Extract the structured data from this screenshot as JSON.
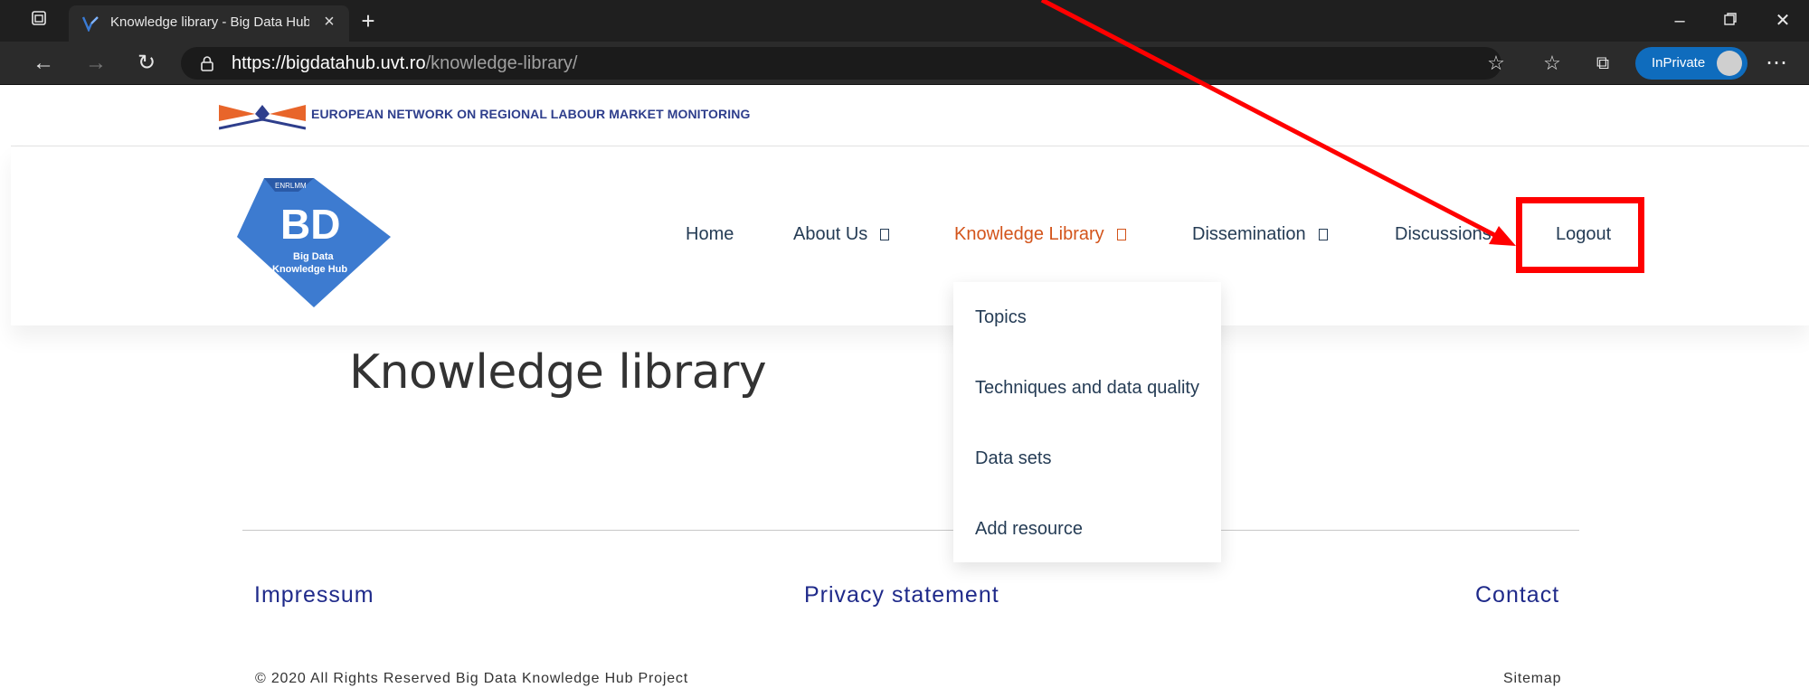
{
  "browser": {
    "tab_title": "Knowledge library - Big Data Hub",
    "url_scheme": "https://",
    "url_host": "bigdatahub.uvt.ro",
    "url_path": "/knowledge-library/",
    "inprivate_label": "InPrivate"
  },
  "site": {
    "network_name": "EUROPEAN NETWORK ON REGIONAL LABOUR MARKET MONITORING",
    "logo_small_text": "ENRLMM",
    "logo_letters": "BD",
    "logo_caption_line1": "Big Data",
    "logo_caption_line2": "Knowledge Hub"
  },
  "nav": {
    "home": "Home",
    "about": "About Us",
    "knowledge_library": "Knowledge Library",
    "dissemination": "Dissemination",
    "discussions": "Discussions",
    "logout": "Logout"
  },
  "dropdown": {
    "items": [
      "Topics",
      "Techniques and data quality",
      "Data sets",
      "Add resource"
    ]
  },
  "main": {
    "page_title": "Knowledge library"
  },
  "footer": {
    "impressum": "Impressum",
    "privacy": "Privacy statement",
    "contact": "Contact",
    "copyright": "© 2020 All Rights Reserved Big Data Knowledge Hub Project",
    "sitemap": "Sitemap"
  },
  "colors": {
    "accent_active": "#d3541b",
    "nav_text": "#253c55",
    "footer_link": "#1f2a8a",
    "annotation": "#ff0000"
  }
}
